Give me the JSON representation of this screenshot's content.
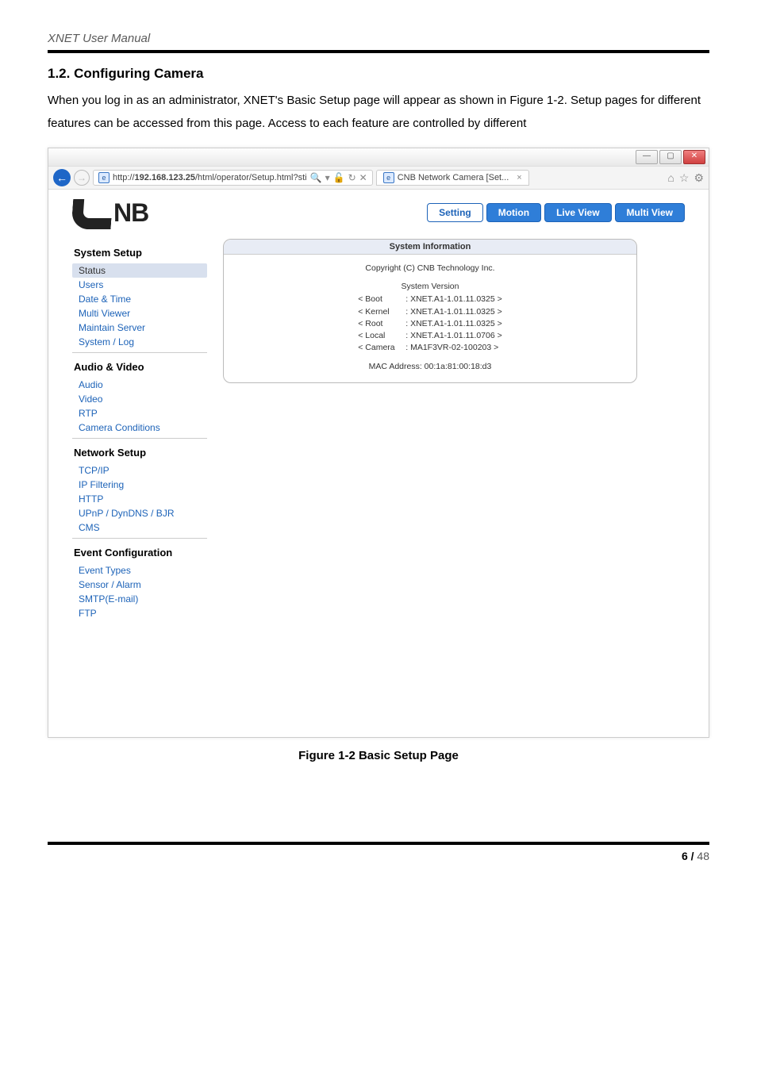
{
  "doc_header": "XNET User Manual",
  "section_number_title": "1.2. Configuring Camera",
  "intro_text": "When you log in as an administrator, XNET's Basic Setup page will appear as shown in Figure 1-2. Setup pages for different features can be accessed from this page. Access to each feature are controlled by different",
  "window": {
    "min_label": "—",
    "max_label": "▢",
    "close_label": "✕"
  },
  "address_bar": {
    "url_prefix": "http://",
    "url_bold": "192.168.123.25",
    "url_suffix": "/html/operator/Setup.html?sti",
    "search_icon": "🔍",
    "dropdown_icon": "▾",
    "refresh_icon": "↻",
    "stop_icon": "✕",
    "lock_icon": "🔓"
  },
  "tab": {
    "title": "CNB Network Camera [Set...",
    "close_icon": "×"
  },
  "toolbar": {
    "home_icon": "⌂",
    "star_icon": "☆",
    "gear_icon": "⚙"
  },
  "logo_text_right": "NB",
  "top_tabs": {
    "setting": "Setting",
    "motion": "Motion",
    "live_view": "Live View",
    "multi_view": "Multi View"
  },
  "sidebar": {
    "group1": {
      "title": "System Setup",
      "items": [
        "Status",
        "Users",
        "Date & Time",
        "Multi Viewer",
        "Maintain Server",
        "System / Log"
      ]
    },
    "group2": {
      "title": "Audio & Video",
      "items": [
        "Audio",
        "Video",
        "RTP",
        "Camera Conditions"
      ]
    },
    "group3": {
      "title": "Network Setup",
      "items": [
        "TCP/IP",
        "IP Filtering",
        "HTTP",
        "UPnP / DynDNS / BJR",
        "CMS"
      ]
    },
    "group4": {
      "title": "Event Configuration",
      "items": [
        "Event Types",
        "Sensor / Alarm",
        "SMTP(E-mail)",
        "FTP"
      ]
    }
  },
  "panel": {
    "header": "System Information",
    "copyright": "Copyright (C) CNB Technology Inc.",
    "version_title": "System Version",
    "rows": [
      {
        "k": "< Boot",
        "v": ": XNET.A1-1.01.11.0325 >"
      },
      {
        "k": "< Kernel",
        "v": ": XNET.A1-1.01.11.0325 >"
      },
      {
        "k": "< Root",
        "v": ": XNET.A1-1.01.11.0325 >"
      },
      {
        "k": "< Local",
        "v": ": XNET.A1-1.01.11.0706 >"
      },
      {
        "k": "< Camera",
        "v": ": MA1F3VR-02-100203 >"
      }
    ],
    "mac_label": "MAC Address: 00:1a:81:00:18:d3"
  },
  "figure_caption": "Figure 1-2 Basic Setup Page",
  "page_num_bold": "6 /",
  "page_num_rest": " 48"
}
